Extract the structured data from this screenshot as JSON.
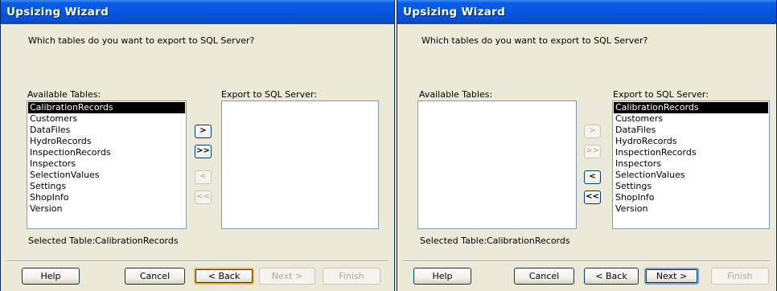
{
  "left": {
    "title": "Upsizing Wizard",
    "question": "Which tables do you want to export to SQL Server?",
    "available_label": "Available Tables:",
    "export_label": "Export to SQL Server:",
    "available_tables": [
      "CalibrationRecords",
      "Customers",
      "DataFiles",
      "HydroRecords",
      "InspectionRecords",
      "Inspectors",
      "SelectionValues",
      "Settings",
      "ShopInfo",
      "Version"
    ],
    "selected_available_index": 0,
    "export_tables": [],
    "selected_table_label": "Selected Table:",
    "selected_table_value": "CalibrationRecords",
    "arrows": {
      "add_one": ">",
      "add_all": ">>",
      "remove_one": "<",
      "remove_all": "<<"
    },
    "buttons": {
      "help": "Help",
      "cancel": "Cancel",
      "back": "< Back",
      "next": "Next >",
      "finish": "Finish"
    }
  },
  "right": {
    "title": "Upsizing Wizard",
    "question": "Which tables do you want to export to SQL Server?",
    "available_label": "Available Tables:",
    "export_label": "Export to SQL Server:",
    "available_tables": [],
    "export_tables": [
      "CalibrationRecords",
      "Customers",
      "DataFiles",
      "HydroRecords",
      "InspectionRecords",
      "Inspectors",
      "SelectionValues",
      "Settings",
      "ShopInfo",
      "Version"
    ],
    "selected_export_index": 0,
    "selected_table_label": "Selected Table:",
    "selected_table_value": "CalibrationRecords",
    "arrows": {
      "add_one": ">",
      "add_all": ">>",
      "remove_one": "<",
      "remove_all": "<<"
    },
    "buttons": {
      "help": "Help",
      "cancel": "Cancel",
      "back": "< Back",
      "next": "Next >",
      "finish": "Finish"
    }
  }
}
